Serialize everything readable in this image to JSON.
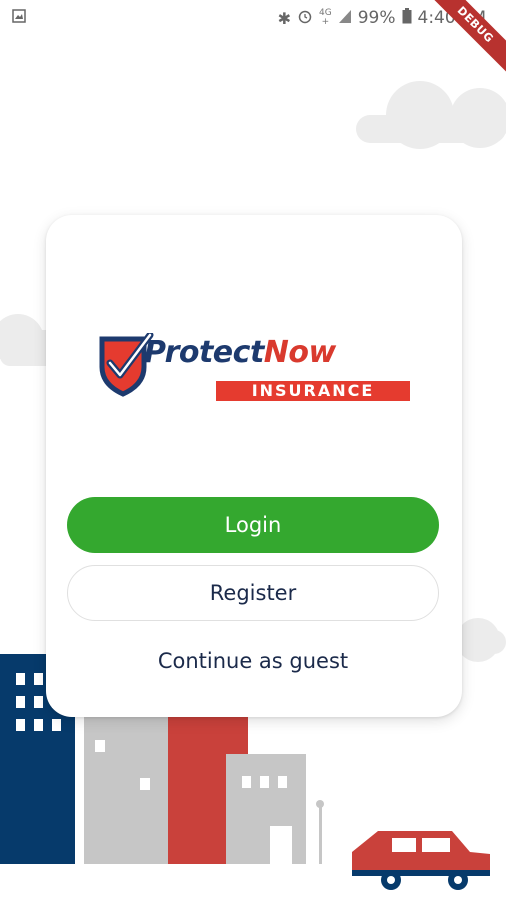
{
  "status_bar": {
    "network_top": "4G",
    "network_bottom": "+",
    "battery": "99%",
    "time": "4:40 PM"
  },
  "debug_banner": {
    "label": "DEBUG"
  },
  "logo": {
    "word_left": "Protect",
    "word_right": "Now",
    "subtitle": "INSURANCE"
  },
  "actions": {
    "login_label": "Login",
    "register_label": "Register",
    "guest_label": "Continue as guest"
  },
  "colors": {
    "login_bg": "#34a82f",
    "brand_navy": "#1d3a6e",
    "brand_red": "#e53b2f",
    "building_navy": "#063a6b",
    "building_red": "#c9413b",
    "building_gray": "#c6c6c6"
  }
}
